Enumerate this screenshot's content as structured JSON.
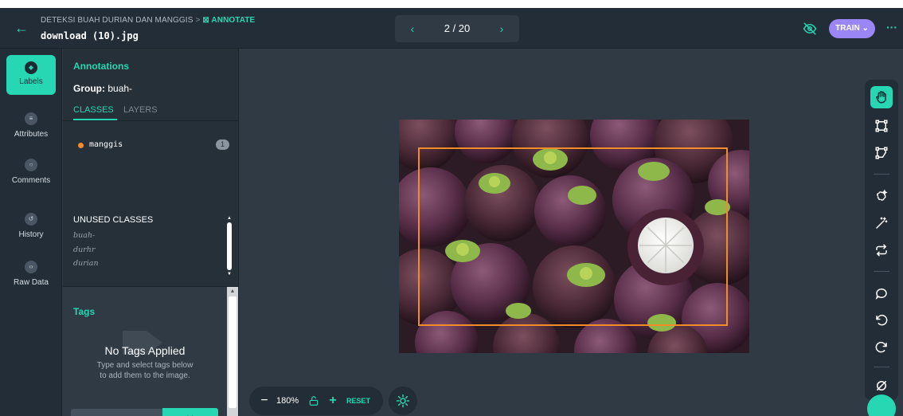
{
  "header": {
    "breadcrumb_project": "DETEKSI BUAH DURIAN DAN MANGGIS",
    "breadcrumb_separator": ">",
    "breadcrumb_section": "ANNOTATE",
    "filename": "download (10).jpg",
    "pager_prev": "‹",
    "pager_next": "›",
    "pager_text": "2 / 20",
    "train_label": "TRAIN ⌄",
    "more_label": "···"
  },
  "nav": {
    "items": [
      {
        "label": "Labels",
        "icon": "labels-icon",
        "active": true
      },
      {
        "label": "Attributes",
        "icon": "attributes-icon"
      },
      {
        "label": "Comments",
        "icon": "comments-icon"
      },
      {
        "label": "History",
        "icon": "history-icon"
      },
      {
        "label": "Raw Data",
        "icon": "raw-data-icon"
      }
    ]
  },
  "panel": {
    "title": "Annotations",
    "group_prefix": "Group:",
    "group_name": "buah-",
    "tabs": [
      "CLASSES",
      "LAYERS"
    ],
    "classes": [
      {
        "name": "manggis",
        "count": "1",
        "color": "#f28c28"
      }
    ],
    "unused_title": "UNUSED CLASSES",
    "unused_classes": [
      "buah-",
      "durhr",
      "durian"
    ]
  },
  "tags": {
    "title": "Tags",
    "empty_title": "No Tags Applied",
    "empty_sub_line1": "Type and select tags below",
    "empty_sub_line2": "to add them to the image.",
    "add_button": "+ Add Tag"
  },
  "zoom": {
    "minus": "−",
    "level": "180%",
    "plus": "+",
    "reset": "RESET"
  },
  "colors": {
    "accent": "#27d6b3",
    "train": "#9a86f4",
    "bbox": "#f28c28"
  }
}
